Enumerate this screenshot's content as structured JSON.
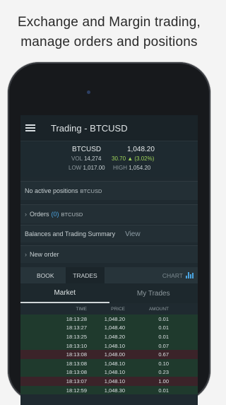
{
  "headline": {
    "line1": "Exchange and Margin trading,",
    "line2": "manage orders and positions"
  },
  "app": {
    "title": "Trading - BTCUSD"
  },
  "ticker": {
    "symbol": "BTCUSD",
    "price": "1,048.20",
    "vol_label": "VOL",
    "vol": "14,274",
    "change": "30.70 ▲ (3.02%)",
    "low_label": "LOW",
    "low": "1,017.00",
    "high_label": "HIGH",
    "high": "1,054.20"
  },
  "positions": {
    "text": "No active positions",
    "symbol": "BTCUSD"
  },
  "orders": {
    "label": "Orders",
    "count": "(0)",
    "symbol": "BTCUSD"
  },
  "balances": {
    "label": "Balances and Trading Summary",
    "view": "View"
  },
  "new_order": {
    "label": "New order"
  },
  "tabs": {
    "book": "BOOK",
    "trades": "TRADES",
    "chart": "CHART"
  },
  "subtabs": {
    "market": "Market",
    "my_trades": "My Trades"
  },
  "table": {
    "headers": {
      "time": "TIME",
      "price": "PRICE",
      "amount": "AMOUNT"
    },
    "rows": [
      {
        "time": "18:13:28",
        "price": "1,048.20",
        "amount": "0.01",
        "side": "buy"
      },
      {
        "time": "18:13:27",
        "price": "1,048.40",
        "amount": "0.01",
        "side": "buy"
      },
      {
        "time": "18:13:25",
        "price": "1,048.20",
        "amount": "0.01",
        "side": "buy"
      },
      {
        "time": "18:13:10",
        "price": "1,048.10",
        "amount": "0.07",
        "side": "buy"
      },
      {
        "time": "18:13:08",
        "price": "1,048.00",
        "amount": "0.67",
        "side": "sell"
      },
      {
        "time": "18:13:08",
        "price": "1,048.10",
        "amount": "0.10",
        "side": "buy"
      },
      {
        "time": "18:13:08",
        "price": "1,048.10",
        "amount": "0.23",
        "side": "buy"
      },
      {
        "time": "18:13:07",
        "price": "1,048.10",
        "amount": "1.00",
        "side": "sell"
      },
      {
        "time": "18:12:59",
        "price": "1,048.30",
        "amount": "0.01",
        "side": "buy"
      }
    ]
  },
  "colors": {
    "accent_blue": "#4aa3df",
    "positive_green": "#9fd35a",
    "buy_row": "#1f3a2d",
    "sell_row": "#3b2329"
  }
}
